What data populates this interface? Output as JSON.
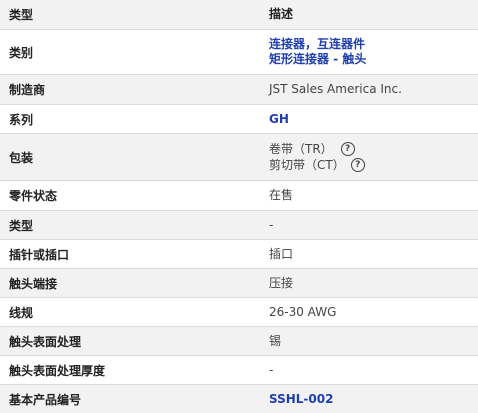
{
  "header": {
    "label": "类型",
    "value": "描述"
  },
  "rows": [
    {
      "label": "类别",
      "links": [
        "连接器，互连器件",
        "矩形连接器 - 触头"
      ]
    },
    {
      "label": "制造商",
      "value": "JST Sales America Inc."
    },
    {
      "label": "系列",
      "link": "GH"
    },
    {
      "label": "包装",
      "packaging": [
        "卷带（TR）",
        "剪切带（CT）"
      ],
      "help_icon": "question-circle-icon"
    },
    {
      "label": "零件状态",
      "value": "在售"
    },
    {
      "label": "类型",
      "value": "-"
    },
    {
      "label": "插针或插口",
      "value": "插口"
    },
    {
      "label": "触头端接",
      "value": "压接"
    },
    {
      "label": "线规",
      "value": "26-30 AWG"
    },
    {
      "label": "触头表面处理",
      "value": "锡"
    },
    {
      "label": "触头表面处理厚度",
      "value": "-"
    },
    {
      "label": "基本产品编号",
      "link": "SSHL-002"
    }
  ],
  "colors": {
    "link": "#1f3fb0",
    "alt_row": "#f2f2f2",
    "border": "#dcdcdc"
  }
}
